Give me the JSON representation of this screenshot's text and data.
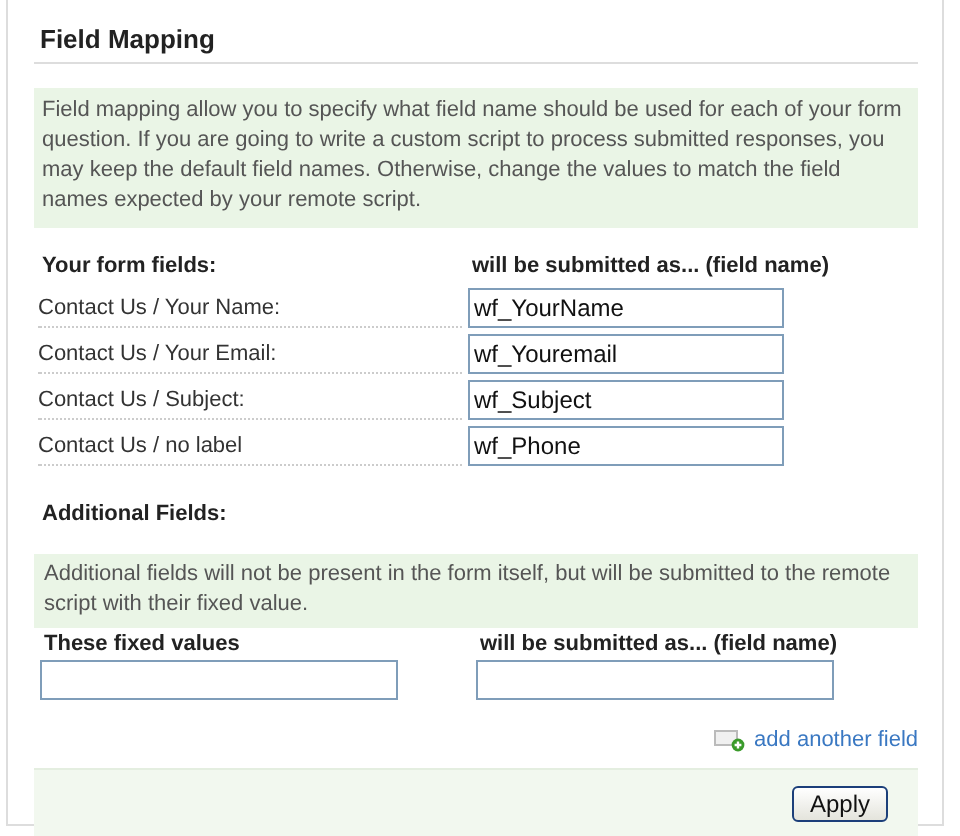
{
  "title": "Field Mapping",
  "intro": "Field mapping allow you to specify what field name should be used for each of your form question. If you are going to write a custom script to process submitted responses, you may keep the default field names. Otherwise, change the values to match the field names expected by your remote script.",
  "mapping": {
    "columns": [
      "Your form fields:",
      "will be submitted as... (field name)"
    ],
    "rows": [
      {
        "label": "Contact Us / Your Name:",
        "value": "wf_YourName"
      },
      {
        "label": "Contact Us / Your Email:",
        "value": "wf_Youremail"
      },
      {
        "label": "Contact Us / Subject:",
        "value": "wf_Subject"
      },
      {
        "label": "Contact Us / no label",
        "value": "wf_Phone"
      }
    ]
  },
  "additional": {
    "heading": "Additional Fields:",
    "note": "Additional fields will not be present in the form itself, but will be submitted to the remote script with their fixed value.",
    "columns": [
      "These fixed values",
      "will be submitted as... (field name)"
    ],
    "add_link": "add another field"
  },
  "buttons": [
    "Apply"
  ]
}
